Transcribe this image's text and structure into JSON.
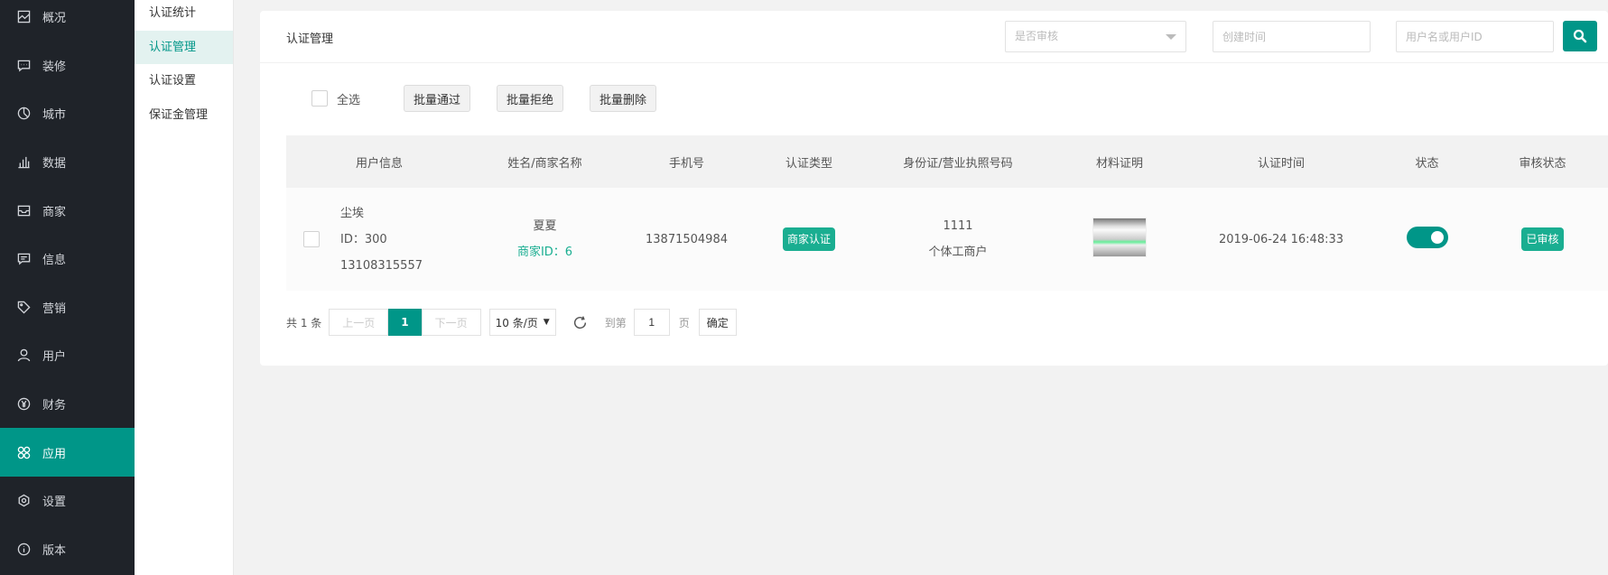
{
  "sidebar": {
    "items": [
      {
        "label": "概况",
        "icon": "overview-icon"
      },
      {
        "label": "装修",
        "icon": "decoration-icon"
      },
      {
        "label": "城市",
        "icon": "city-icon"
      },
      {
        "label": "数据",
        "icon": "data-chart-icon"
      },
      {
        "label": "商家",
        "icon": "merchant-icon"
      },
      {
        "label": "信息",
        "icon": "message-icon"
      },
      {
        "label": "营销",
        "icon": "tag-icon"
      },
      {
        "label": "用户",
        "icon": "user-icon"
      },
      {
        "label": "财务",
        "icon": "yen-icon"
      },
      {
        "label": "应用",
        "icon": "apps-icon",
        "active": true
      },
      {
        "label": "设置",
        "icon": "settings-icon"
      },
      {
        "label": "版本",
        "icon": "info-icon"
      }
    ]
  },
  "subnav": {
    "items": [
      {
        "label": "认证统计"
      },
      {
        "label": "认证管理",
        "active": true
      },
      {
        "label": "认证设置"
      },
      {
        "label": "保证金管理"
      }
    ]
  },
  "header": {
    "title": "认证管理",
    "review_select_placeholder": "是否审核",
    "time_placeholder": "创建时间",
    "user_placeholder": "用户名或用户ID"
  },
  "toolbar": {
    "select_all": "全选",
    "batch_approve": "批量通过",
    "batch_reject": "批量拒绝",
    "batch_delete": "批量删除"
  },
  "table": {
    "columns": [
      "用户信息",
      "姓名/商家名称",
      "手机号",
      "认证类型",
      "身份证/营业执照号码",
      "材料证明",
      "认证时间",
      "状态",
      "审核状态"
    ],
    "rows": [
      {
        "user_name": "尘埃",
        "user_id": "ID：300",
        "user_phone": "13108315557",
        "name": "夏夏",
        "merchant_id": "商家ID：6",
        "phone": "13871504984",
        "auth_type": "商家认证",
        "id_number": "1111",
        "business_type": "个体工商户",
        "auth_time": "2019-06-24 16:48:33",
        "status_on": true,
        "review_status": "已审核"
      }
    ]
  },
  "pagination": {
    "total": "共 1 条",
    "prev": "上一页",
    "current": "1",
    "next": "下一页",
    "page_size": "10 条/页",
    "goto_label": "到第",
    "goto_value": "1",
    "page_unit": "页",
    "confirm": "确定"
  },
  "colors": {
    "accent": "#009688",
    "sidebar_bg": "#1f2329",
    "tag_green": "#1aae91"
  }
}
